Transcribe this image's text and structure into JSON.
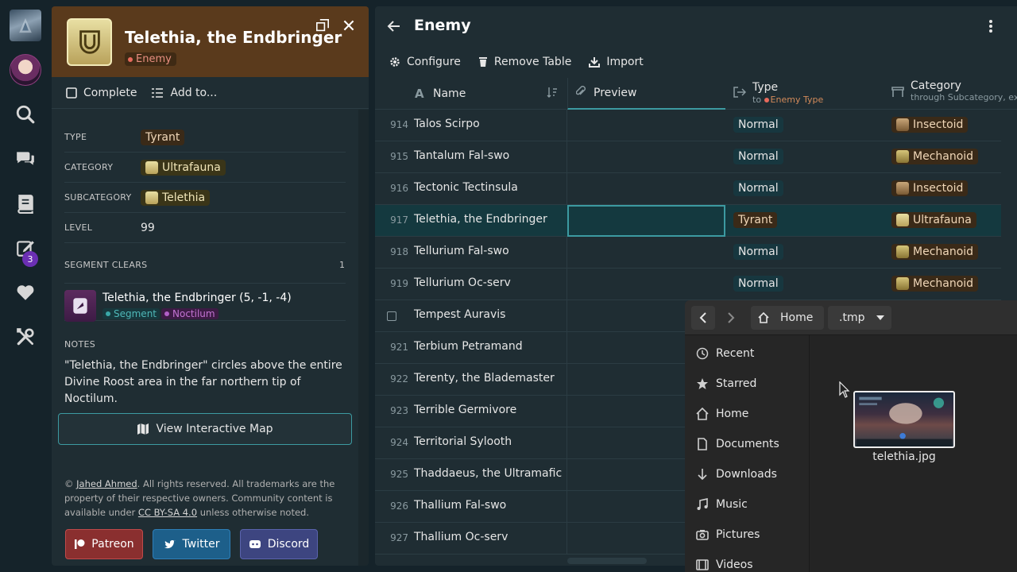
{
  "detail": {
    "title": "Telethia, the Endbringer",
    "tag": "Enemy",
    "actions": {
      "complete": "Complete",
      "add_to": "Add to..."
    },
    "props": [
      {
        "label": "TYPE",
        "value": "Tyrant"
      },
      {
        "label": "CATEGORY",
        "value": "Ultrafauna"
      },
      {
        "label": "SUBCATEGORY",
        "value": "Telethia"
      },
      {
        "label": "LEVEL",
        "value": "99"
      }
    ],
    "segment_clears": {
      "label": "SEGMENT CLEARS",
      "count": "1",
      "item_title": "Telethia, the Endbringer (5, -1, -4)",
      "tags": [
        "Segment",
        "Noctilum"
      ]
    },
    "notes_label": "NOTES",
    "notes": "\"Telethia, the Endbringer\" circles above the entire Divine Roost area in the far northern tip of Noctilum.",
    "map_button": "View Interactive Map",
    "footer": {
      "prefix": "©",
      "author": "Jahed Ahmed",
      "line1": ". All rights reserved. All trademarks are the property of their respective owners. Community content is available under",
      "license": "CC BY-SA 4.0",
      "line2": "unless otherwise noted."
    },
    "social": {
      "patreon": "Patreon",
      "twitter": "Twitter",
      "discord": "Discord"
    }
  },
  "rail": {
    "notification_count": "3"
  },
  "table": {
    "title": "Enemy",
    "toolbar": {
      "configure": "Configure",
      "remove": "Remove Table",
      "import": "Import"
    },
    "columns": {
      "name": "Name",
      "preview": "Preview",
      "type": "Type",
      "type_sub_prefix": "to",
      "type_sub": "Enemy Type",
      "category": "Category",
      "category_sub": "through Subcategory, exit"
    },
    "rows": [
      {
        "num": "914",
        "name": "Talos Scirpo",
        "type": "Normal",
        "category": "Insectoid"
      },
      {
        "num": "915",
        "name": "Tantalum Fal-swo",
        "type": "Normal",
        "category": "Mechanoid"
      },
      {
        "num": "916",
        "name": "Tectonic Tectinsula",
        "type": "Normal",
        "category": "Insectoid"
      },
      {
        "num": "917",
        "name": "Telethia, the Endbringer",
        "type": "Tyrant",
        "category": "Ultrafauna"
      },
      {
        "num": "918",
        "name": "Tellurium Fal-swo",
        "type": "Normal",
        "category": "Mechanoid"
      },
      {
        "num": "919",
        "name": "Tellurium Oc-serv",
        "type": "Normal",
        "category": "Mechanoid"
      },
      {
        "num": "",
        "name": "Tempest Auravis",
        "type": "",
        "category": ""
      },
      {
        "num": "921",
        "name": "Terbium Petramand",
        "type": "",
        "category": ""
      },
      {
        "num": "922",
        "name": "Terenty, the Blademaster",
        "type": "",
        "category": ""
      },
      {
        "num": "923",
        "name": "Terrible Germivore",
        "type": "",
        "category": ""
      },
      {
        "num": "924",
        "name": "Territorial Sylooth",
        "type": "",
        "category": ""
      },
      {
        "num": "925",
        "name": "Thaddaeus, the Ultramafic",
        "type": "",
        "category": ""
      },
      {
        "num": "926",
        "name": "Thallium Fal-swo",
        "type": "",
        "category": ""
      },
      {
        "num": "927",
        "name": "Thallium Oc-serv",
        "type": "",
        "category": ""
      }
    ]
  },
  "chooser": {
    "crumbs": [
      "Home",
      ".tmp"
    ],
    "places": [
      "Recent",
      "Starred",
      "Home",
      "Documents",
      "Downloads",
      "Music",
      "Pictures",
      "Videos"
    ],
    "file": "telethia.jpg"
  },
  "colors": {
    "accent": "#3c9aa1",
    "header_brown": "#5a3a1c",
    "tyrant_chip": "#3a2a18",
    "normal_chip": "#17373f"
  }
}
